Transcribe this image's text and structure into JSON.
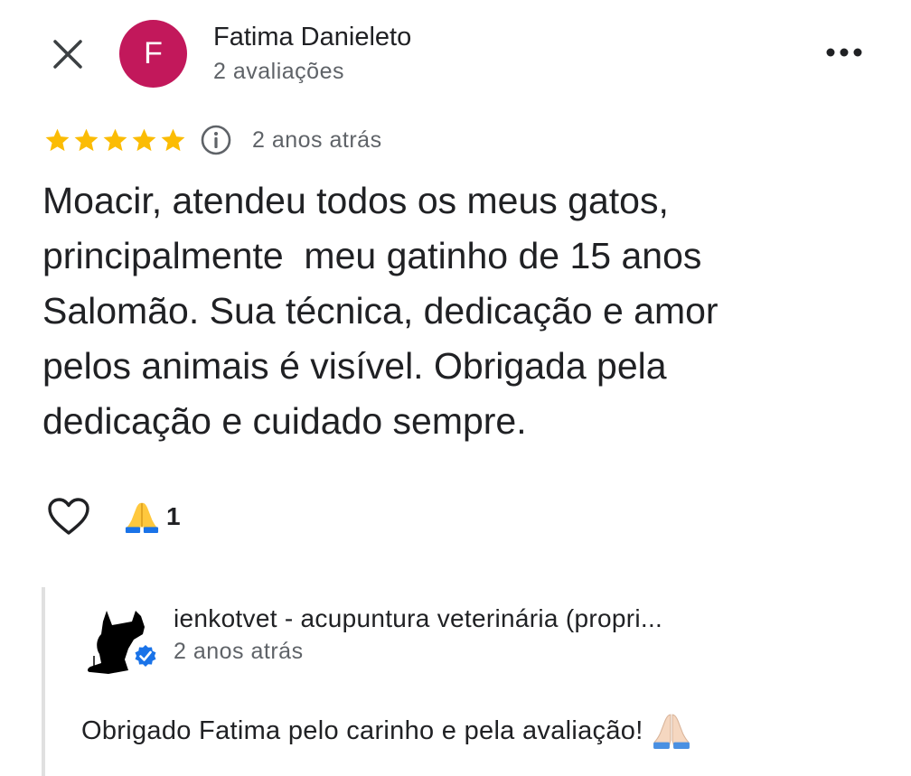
{
  "header": {
    "close_icon": "close-icon",
    "avatar_letter": "F",
    "avatar_color": "#c2185b",
    "author_name": "Fatima Danieleto",
    "author_reviews": "2 avaliações",
    "more_icon": "more-horizontal-icon"
  },
  "rating": {
    "stars": 5,
    "max_stars": 5,
    "star_color": "#fbbc04",
    "info_icon": "info-icon",
    "date": "2 anos atrás"
  },
  "review": {
    "text": "Moacir, atendeu todos os meus gatos,\nprincipalmente  meu gatinho de 15 anos\nSalomão. Sua técnica, dedicação e amor\npelos animais é visível. Obrigada pela\ndedicação e cuidado sempre."
  },
  "reactions": {
    "like_icon": "heart-outline-icon",
    "emoji_icon": "folded-hands-emoji",
    "emoji_count": "1"
  },
  "owner_reply": {
    "avatar_icon": "dog-silhouette-logo",
    "verified_icon": "verified-badge-icon",
    "verified_color": "#1a73e8",
    "name": "ienkotvet - acupuntura veterinária (propri...",
    "date": "2 anos atrás",
    "text": "Obrigado Fatima pelo carinho e pela avaliação!",
    "text_emoji": "folded-hands-emoji"
  }
}
